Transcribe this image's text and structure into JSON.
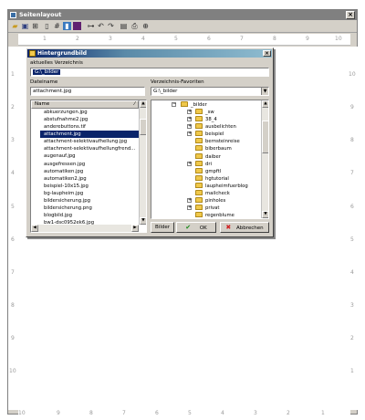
{
  "window": {
    "title": "Seitenlayout",
    "close": "×"
  },
  "ruler_top": [
    "1",
    "2",
    "3",
    "4",
    "5",
    "6",
    "7",
    "8",
    "9",
    "10"
  ],
  "ruler_left": [
    "1",
    "2",
    "3",
    "4",
    "5",
    "6",
    "7",
    "8",
    "9",
    "10"
  ],
  "ruler_right": [
    "10",
    "9",
    "8",
    "7",
    "6",
    "5",
    "4",
    "3",
    "2",
    "1"
  ],
  "ruler_bottom": [
    "10",
    "9",
    "8",
    "7",
    "6",
    "5",
    "4",
    "3",
    "2",
    "1"
  ],
  "dialog": {
    "title": "Hintergrundbild",
    "close": "×",
    "current_dir_label": "aktuelles Verzeichnis",
    "current_dir_value": "G:\\_bilder",
    "filename_label": "Dateiname",
    "filename_value": "attachment.jpg",
    "favorites_label": "Verzeichnis-Favoriten",
    "favorites_value": "G:\\_bilder",
    "list_header": "Name",
    "files": [
      "abkuerzungen.jpg",
      "abstufnahme2.jpg",
      "anderebuttons.tif",
      "attachment.jpg",
      "attachment-selektivaufhellung.jpg",
      "attachment-selektivaufhellungfrend...",
      "augenauf.jpg",
      "ausgefressen.jpg",
      "automatiken.jpg",
      "automatiken2.jpg",
      "beispiel-10x15.jpg",
      "bg-laupheim.jpg",
      "bildersicherung.jpg",
      "bildersicherung.png",
      "blogbild.jpg",
      "bw1-dsc0952ek6.jpg"
    ],
    "selected_file_index": 3,
    "tree_root": "_bilder",
    "tree": [
      {
        "name": "_sw",
        "expand": "+"
      },
      {
        "name": "38_4",
        "expand": "+"
      },
      {
        "name": "ausbelichten",
        "expand": "+"
      },
      {
        "name": "beispiel",
        "expand": "+"
      },
      {
        "name": "bernsteinreise",
        "expand": ""
      },
      {
        "name": "biberbaum",
        "expand": ""
      },
      {
        "name": "daiber",
        "expand": ""
      },
      {
        "name": "dri",
        "expand": "+"
      },
      {
        "name": "gmpftl",
        "expand": ""
      },
      {
        "name": "hgtutorial",
        "expand": ""
      },
      {
        "name": "laupheimfuerblog",
        "expand": ""
      },
      {
        "name": "mailcheck",
        "expand": ""
      },
      {
        "name": "pinholes",
        "expand": "+"
      },
      {
        "name": "privat",
        "expand": "+"
      },
      {
        "name": "regenblume",
        "expand": ""
      }
    ],
    "buttons": {
      "bilder": "Bilder",
      "ok": "OK",
      "cancel": "Abbrechen"
    },
    "icons": {
      "ok": "✔",
      "cancel": "✖"
    }
  }
}
